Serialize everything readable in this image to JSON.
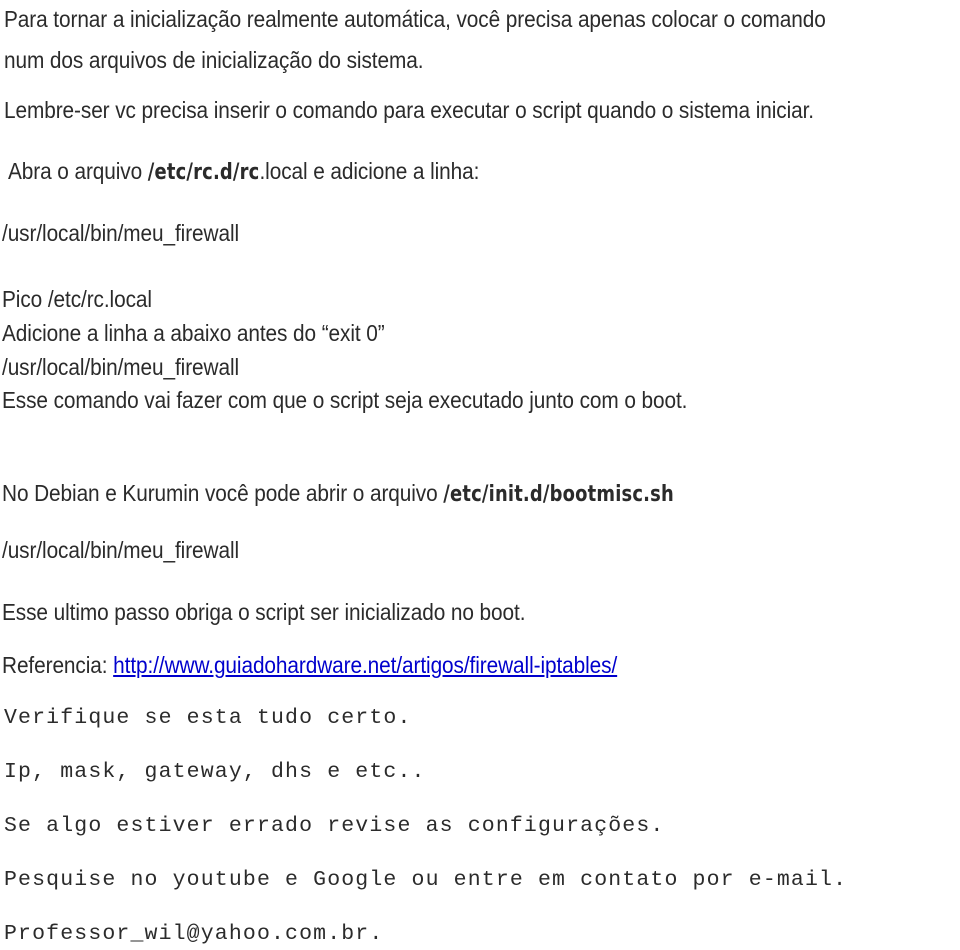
{
  "document": {
    "background_color": "#ffffff",
    "text_color": "#2b2b2b",
    "link_color": "#0000cd",
    "paragraphs": {
      "intro_line1": "Para tornar a inicialização realmente automática, você precisa apenas colocar o comando",
      "intro_line2": "num dos arquivos de inicialização do sistema.",
      "reminder": "Lembre-ser vc precisa inserir o comando para executar o script quando o sistema iniciar.",
      "open_file_prefix": "Abra o arquivo ",
      "open_file_path_bold": "/etc/rc.d/rc",
      "open_file_path_plain": ".local",
      "open_file_suffix": " e adicione a linha:",
      "firewall_path_1": "/usr/local/bin/meu_firewall",
      "pico_command": "Pico /etc/rc.local",
      "add_line_instruction": "Adicione a linha a abaixo antes do “exit 0”",
      "firewall_path_2": "/usr/local/bin/meu_firewall",
      "boot_explanation": "Esse comando vai fazer com que o script seja executado junto com o boot.",
      "debian_prefix": "No Debian e Kurumin você pode abrir o arquivo ",
      "debian_path_bold": "/etc/init.d/bootmisc.sh",
      "firewall_path_3": "/usr/local/bin/meu_firewall",
      "last_step": "Esse ultimo passo obriga o script ser inicializado no boot.",
      "reference_label": "Referencia: ",
      "reference_url": "http://www.guiadohardware.net/artigos/firewall-iptables/"
    },
    "mono_block": {
      "line1": "Verifique se esta tudo certo.",
      "line2": "Ip, mask, gateway, dhs e etc..",
      "line3": "Se algo estiver errado revise as configurações.",
      "line4": "Pesquise no youtube e Google ou entre em contato por e-mail.",
      "line5": "Professor_wil@yahoo.com.br."
    }
  }
}
